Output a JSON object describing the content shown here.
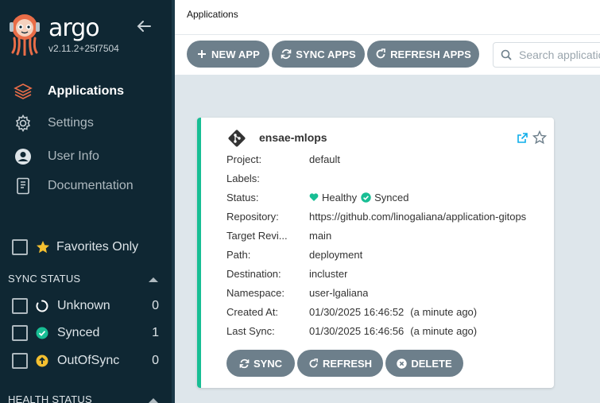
{
  "app": {
    "brand": "argo",
    "version": "v2.11.2+25f7504"
  },
  "nav": [
    {
      "label": "Applications",
      "icon": "layers-icon",
      "active": true
    },
    {
      "label": "Settings",
      "icon": "gear-icon",
      "active": false
    },
    {
      "label": "User Info",
      "icon": "user-circle-icon",
      "active": false
    },
    {
      "label": "Documentation",
      "icon": "book-icon",
      "active": false
    }
  ],
  "filters": {
    "favorites_label": "Favorites Only",
    "sync_status_title": "SYNC STATUS",
    "sync_status": [
      {
        "label": "Unknown",
        "count": "0",
        "icon": "circle-notch-icon"
      },
      {
        "label": "Synced",
        "count": "1",
        "icon": "check-circle-icon"
      },
      {
        "label": "OutOfSync",
        "count": "0",
        "icon": "arrow-up-circle-icon"
      }
    ],
    "health_status_title": "HEALTH STATUS"
  },
  "header": {
    "title": "Applications"
  },
  "toolbar": {
    "new_app": "NEW APP",
    "sync_apps": "SYNC APPS",
    "refresh_apps": "REFRESH APPS",
    "search_placeholder": "Search applications..."
  },
  "card": {
    "title": "ensae-mlops",
    "rows": {
      "project": {
        "k": "Project:",
        "v": "default"
      },
      "labels": {
        "k": "Labels:",
        "v": ""
      },
      "status": {
        "k": "Status:",
        "health": "Healthy",
        "sync": "Synced"
      },
      "repository": {
        "k": "Repository:",
        "v": "https://github.com/linogaliana/application-gitops"
      },
      "target": {
        "k": "Target Revi...",
        "v": "main"
      },
      "path": {
        "k": "Path:",
        "v": "deployment"
      },
      "destination": {
        "k": "Destination:",
        "v": "incluster"
      },
      "namespace": {
        "k": "Namespace:",
        "v": "user-lgaliana"
      },
      "created": {
        "k": "Created At:",
        "v": "01/30/2025 16:46:52",
        "ago": "(a minute ago)"
      },
      "last_sync": {
        "k": "Last Sync:",
        "v": "01/30/2025 16:46:56",
        "ago": "(a minute ago)"
      }
    },
    "buttons": {
      "sync": "SYNC",
      "refresh": "REFRESH",
      "delete": "DELETE"
    }
  },
  "colors": {
    "sidebar_bg": "#0f2733",
    "accent_orange": "#e96d48",
    "healthy_green": "#18be94",
    "button_gray": "#6d7f8b",
    "outofsync_yellow": "#f4c030",
    "link_teal": "#0dadea"
  }
}
